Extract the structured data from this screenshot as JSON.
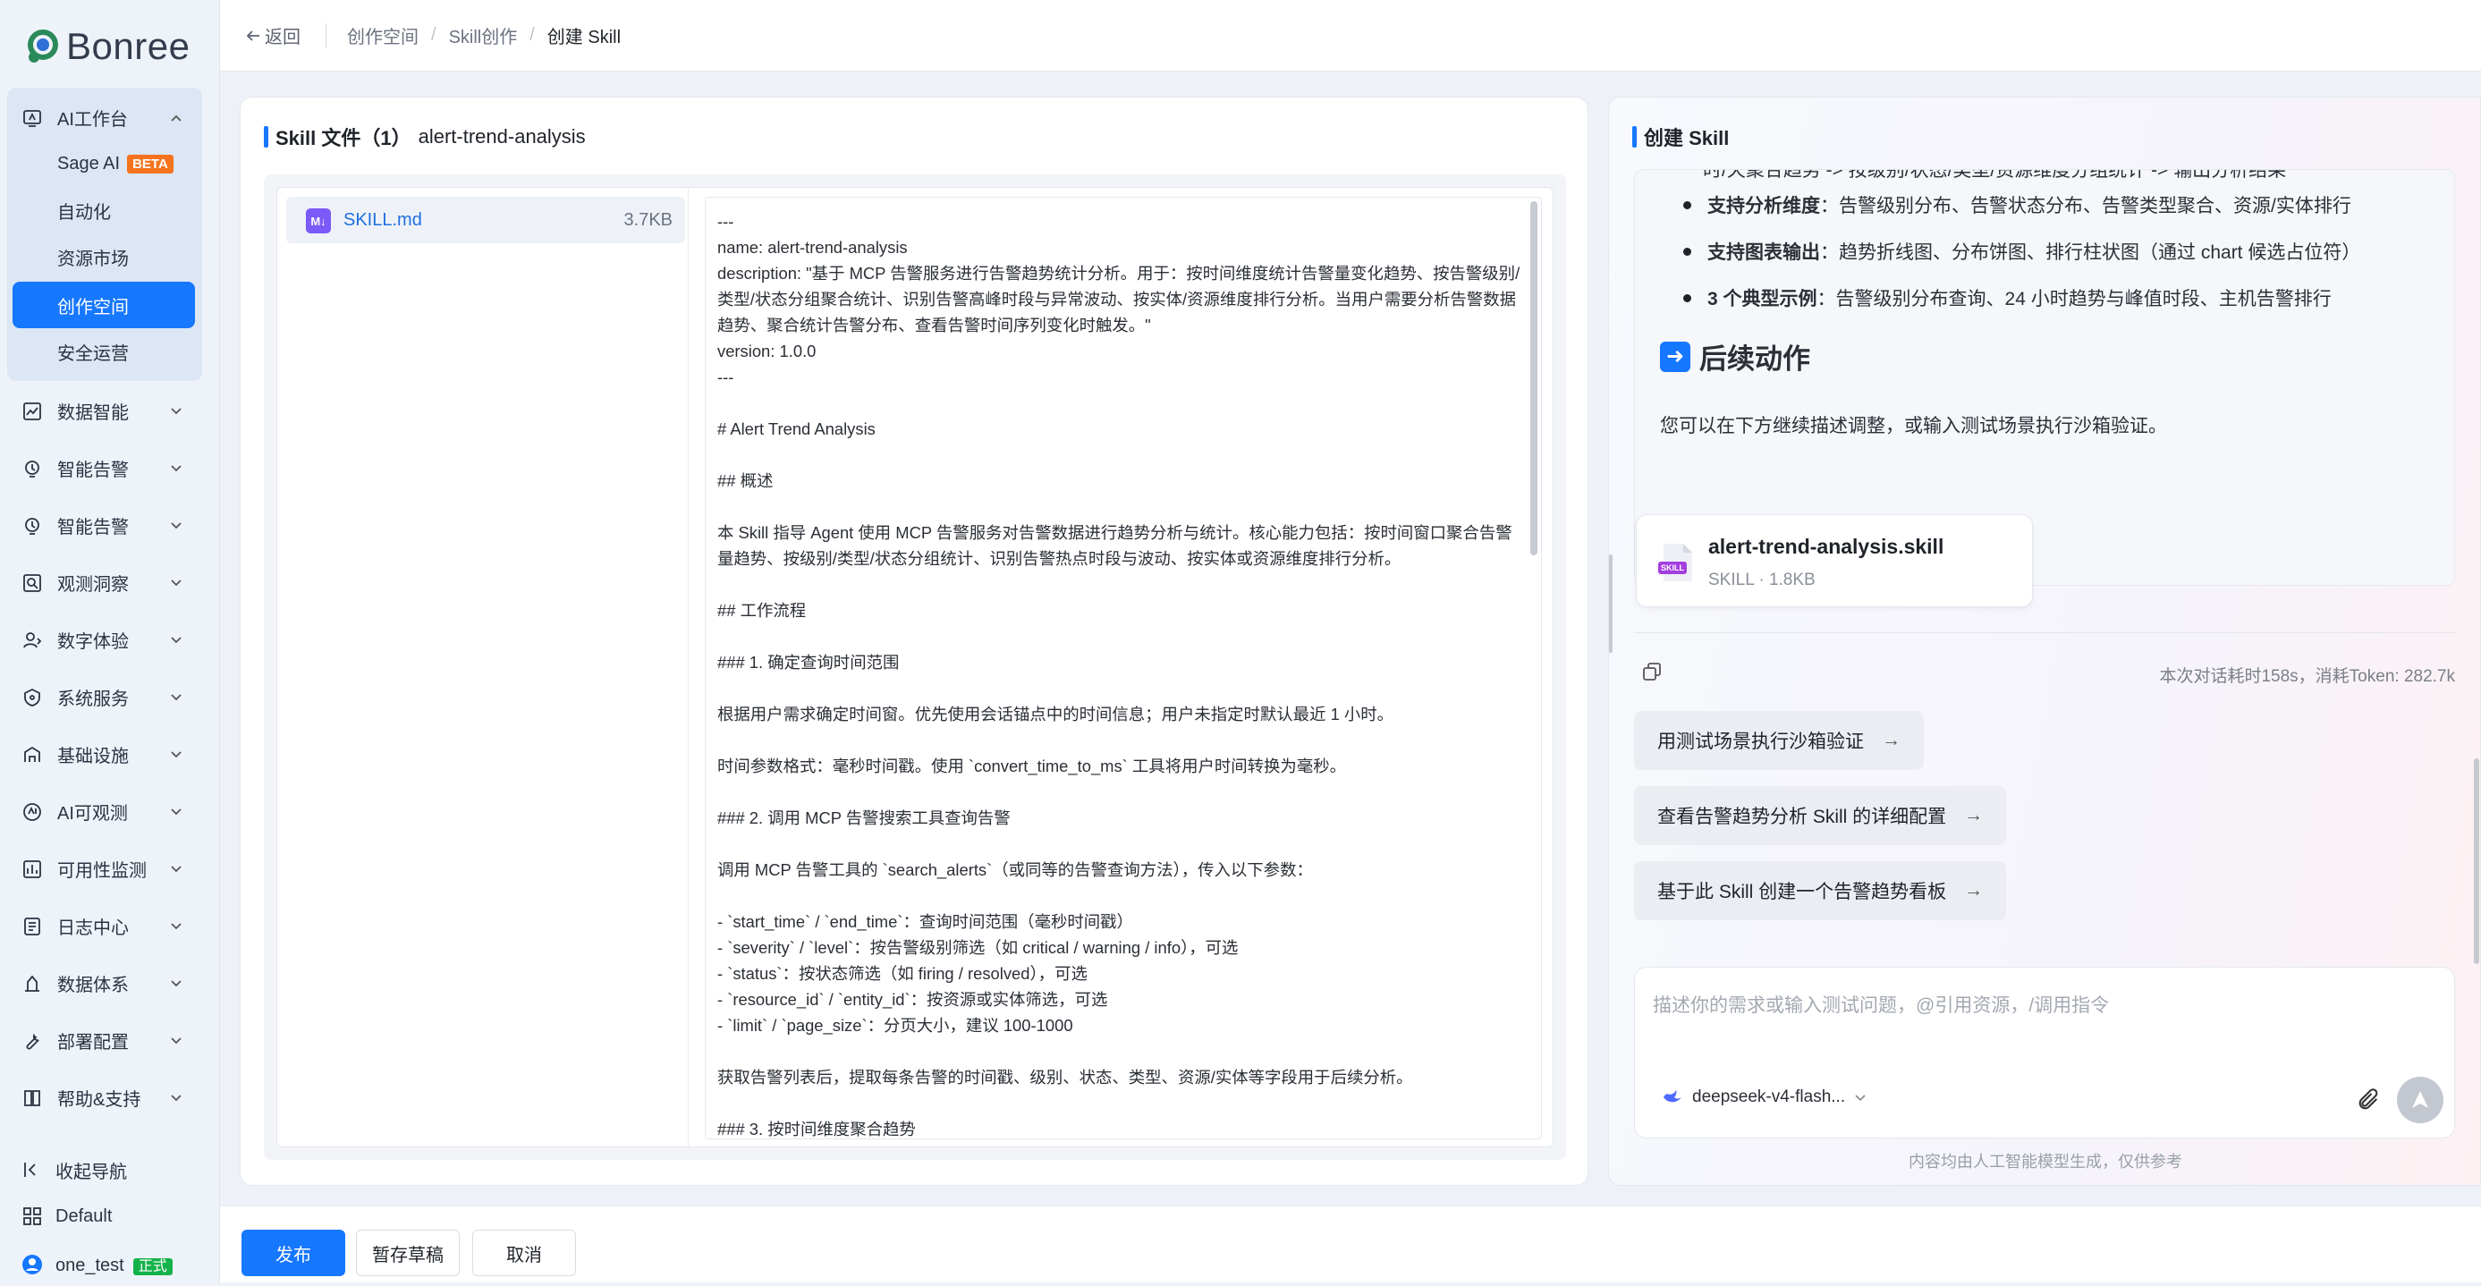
{
  "brand": {
    "name": "Bonree"
  },
  "sidebar": {
    "ai_workbench": "AI工作台",
    "sub_items": [
      {
        "label": "Sage AI",
        "badge": "BETA"
      },
      {
        "label": "自动化"
      },
      {
        "label": "资源市场"
      },
      {
        "label": "创作空间"
      },
      {
        "label": "安全运营"
      }
    ],
    "items": [
      {
        "label": "数据智能",
        "icon": "chart-line-icon"
      },
      {
        "label": "智能告警",
        "icon": "alert-brain-icon"
      },
      {
        "label": "智能告警",
        "icon": "alert-brain-icon"
      },
      {
        "label": "观测洞察",
        "icon": "insight-search-icon"
      },
      {
        "label": "数字体验",
        "icon": "user-experience-icon"
      },
      {
        "label": "系统服务",
        "icon": "system-service-icon"
      },
      {
        "label": "基础设施",
        "icon": "infrastructure-icon"
      },
      {
        "label": "AI可观测",
        "icon": "ai-observe-icon"
      },
      {
        "label": "可用性监测",
        "icon": "availability-icon"
      },
      {
        "label": "日志中心",
        "icon": "log-icon"
      },
      {
        "label": "数据体系",
        "icon": "data-system-icon"
      },
      {
        "label": "部署配置",
        "icon": "wrench-icon"
      },
      {
        "label": "帮助&支持",
        "icon": "book-icon"
      }
    ],
    "collapse": "收起导航",
    "workspace": "Default",
    "user": {
      "name": "one_test",
      "env": "正式"
    }
  },
  "topbar": {
    "back": "返回",
    "breadcrumbs": [
      "创作空间",
      "Skill创作",
      "创建 Skill"
    ]
  },
  "editor": {
    "title": "Skill 文件（1）",
    "skill_id": "alert-trend-analysis",
    "file": {
      "name": "SKILL.md",
      "size": "3.7KB",
      "icon": "markdown-icon"
    },
    "code_lines": [
      "---",
      "name: alert-trend-analysis",
      "description: \"基于 MCP 告警服务进行告警趋势统计分析。用于：按时间维度统计告警量变化趋势、按告警级别/类型/状态分组聚合统计、识别告警高峰时段与异常波动、按实体/资源维度排行分析。当用户需要分析告警数据趋势、聚合统计告警分布、查看告警时间序列变化时触发。\"",
      "version: 1.0.0",
      "---",
      "",
      "# Alert Trend Analysis",
      "",
      "## 概述",
      "",
      "本 Skill 指导 Agent 使用 MCP 告警服务对告警数据进行趋势分析与统计。核心能力包括：按时间窗口聚合告警量趋势、按级别/类型/状态分组统计、识别告警热点时段与波动、按实体或资源维度排行分析。",
      "",
      "## 工作流程",
      "",
      "### 1. 确定查询时间范围",
      "",
      "根据用户需求确定时间窗。优先使用会话锚点中的时间信息；用户未指定时默认最近 1 小时。",
      "",
      "时间参数格式：毫秒时间戳。使用 `convert_time_to_ms` 工具将用户时间转换为毫秒。",
      "",
      "### 2. 调用 MCP 告警搜索工具查询告警",
      "",
      "调用 MCP 告警工具的 `search_alerts`（或同等的告警查询方法），传入以下参数：",
      "",
      "- `start_time` / `end_time`：查询时间范围（毫秒时间戳）",
      "- `severity` / `level`：按告警级别筛选（如 critical / warning / info），可选",
      "- `status`：按状态筛选（如 firing / resolved），可选",
      "- `resource_id` / `entity_id`：按资源或实体筛选，可选",
      "- `limit` / `page_size`：分页大小，建议 100-1000",
      "",
      "获取告警列表后，提取每条告警的时间戳、级别、状态、类型、资源/实体等字段用于后续分析。",
      "",
      "### 3. 按时间维度聚合趋势"
    ]
  },
  "actions": {
    "publish": "发布",
    "save_draft": "暂存草稿",
    "cancel": "取消"
  },
  "chat": {
    "title": "创建 Skill",
    "cut_line": "时/天聚合趋势 -> 按级别/状态/类型/资源维度分组统计 -> 输出分析结果",
    "bullets": [
      {
        "bold": "支持分析维度",
        "text": "：告警级别分布、告警状态分布、告警类型聚合、资源/实体排行"
      },
      {
        "bold": "支持图表输出",
        "text": "：趋势折线图、分布饼图、排行柱状图（通过 chart 候选占位符）"
      },
      {
        "bold": "3 个典型示例",
        "text": "：告警级别分布查询、24 小时趋势与峰值时段、主机告警排行"
      }
    ],
    "next_heading": "后续动作",
    "next_paragraph": "您可以在下方继续描述调整，或输入测试场景执行沙箱验证。",
    "skill_file": {
      "name": "alert-trend-analysis.skill",
      "meta": "SKILL · 1.8KB",
      "icon": "skill-file-icon"
    },
    "stats": "本次对话耗时158s，消耗Token: 282.7k",
    "suggestions": [
      "用测试场景执行沙箱验证",
      "查看告警趋势分析 Skill 的详细配置",
      "基于此 Skill 创建一个告警趋势看板"
    ],
    "input_placeholder": "描述你的需求或输入测试问题，@引用资源，/调用指令",
    "model": "deepseek-v4-flash...",
    "disclaimer": "内容均由人工智能模型生成，仅供参考"
  },
  "colors": {
    "primary": "#1677ff",
    "beta": "#f5731c",
    "env_tag": "#14b24a"
  }
}
